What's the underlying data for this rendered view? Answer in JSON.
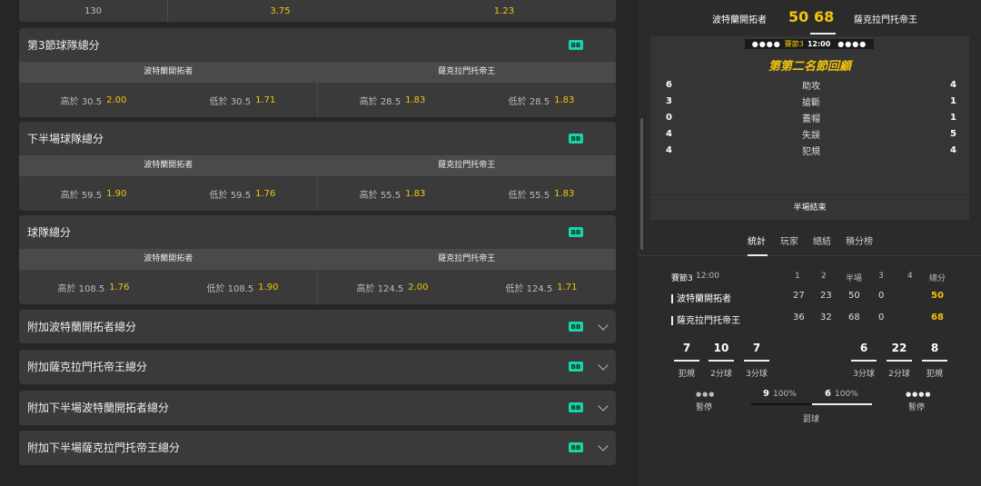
{
  "top_row": {
    "v1": "130",
    "v2": "3.75",
    "v3": "1.23"
  },
  "badge": "BB",
  "markets": [
    {
      "title": "第3節球隊總分",
      "teams": [
        "波特蘭開拓者",
        "薩克拉門托帝王"
      ],
      "odds": [
        [
          "高於 30.5",
          "2.00"
        ],
        [
          "低於 30.5",
          "1.71"
        ],
        [
          "高於 28.5",
          "1.83"
        ],
        [
          "低於 28.5",
          "1.83"
        ]
      ]
    },
    {
      "title": "下半場球隊總分",
      "teams": [
        "波特蘭開拓者",
        "薩克拉門托帝王"
      ],
      "odds": [
        [
          "高於 59.5",
          "1.90"
        ],
        [
          "低於 59.5",
          "1.76"
        ],
        [
          "高於 55.5",
          "1.83"
        ],
        [
          "低於 55.5",
          "1.83"
        ]
      ]
    },
    {
      "title": "球隊總分",
      "teams": [
        "波特蘭開拓者",
        "薩克拉門托帝王"
      ],
      "odds": [
        [
          "高於 108.5",
          "1.76"
        ],
        [
          "低於 108.5",
          "1.90"
        ],
        [
          "高於 124.5",
          "2.00"
        ],
        [
          "低於 124.5",
          "1.71"
        ]
      ]
    }
  ],
  "collapsed": [
    "附加波特蘭開拓者總分",
    "附加薩克拉門托帝王總分",
    "附加下半場波特蘭開拓者總分",
    "附加下半場薩克拉門托帝王總分"
  ],
  "match": {
    "home": "波特蘭開拓者",
    "away": "薩克拉門托帝王",
    "home_score": "50",
    "away_score": "68",
    "period": "賽節3",
    "clock": "12:00",
    "recap_title": "第第二名節回顧",
    "stats": [
      {
        "home": "6",
        "label": "助攻",
        "away": "4"
      },
      {
        "home": "3",
        "label": "搶斷",
        "away": "1"
      },
      {
        "home": "0",
        "label": "蓋帽",
        "away": "1"
      },
      {
        "home": "4",
        "label": "失誤",
        "away": "5"
      },
      {
        "home": "4",
        "label": "犯規",
        "away": "4"
      }
    ],
    "half_end": "半場結束"
  },
  "tabs": [
    "統計",
    "玩家",
    "總結",
    "積分榜"
  ],
  "table": {
    "period_label": "賽節3",
    "clock": "12:00",
    "headers": [
      "1",
      "2",
      "半場",
      "3",
      "4",
      "總分"
    ],
    "rows": [
      {
        "team": "波特蘭開拓者",
        "q": [
          "27",
          "23",
          "50",
          "0",
          ""
        ],
        "total": "50"
      },
      {
        "team": "薩克拉門托帝王",
        "q": [
          "36",
          "32",
          "68",
          "0",
          ""
        ],
        "total": "68"
      }
    ]
  },
  "summary": {
    "home": [
      {
        "v": "7",
        "l": "犯規"
      },
      {
        "v": "10",
        "l": "2分球"
      },
      {
        "v": "7",
        "l": "3分球"
      }
    ],
    "away": [
      {
        "v": "6",
        "l": "3分球"
      },
      {
        "v": "22",
        "l": "2分球"
      },
      {
        "v": "8",
        "l": "犯規"
      }
    ],
    "timeout_label": "暫停",
    "ft_home": "9",
    "ft_home_pct": "100%",
    "ft_away": "6",
    "ft_away_pct": "100%",
    "ft_label": "罰球",
    "home_timeouts_remaining": 3,
    "away_timeouts_remaining": 4
  },
  "colors": {
    "accent": "#f2c40c",
    "badge": "#17d6a0"
  }
}
